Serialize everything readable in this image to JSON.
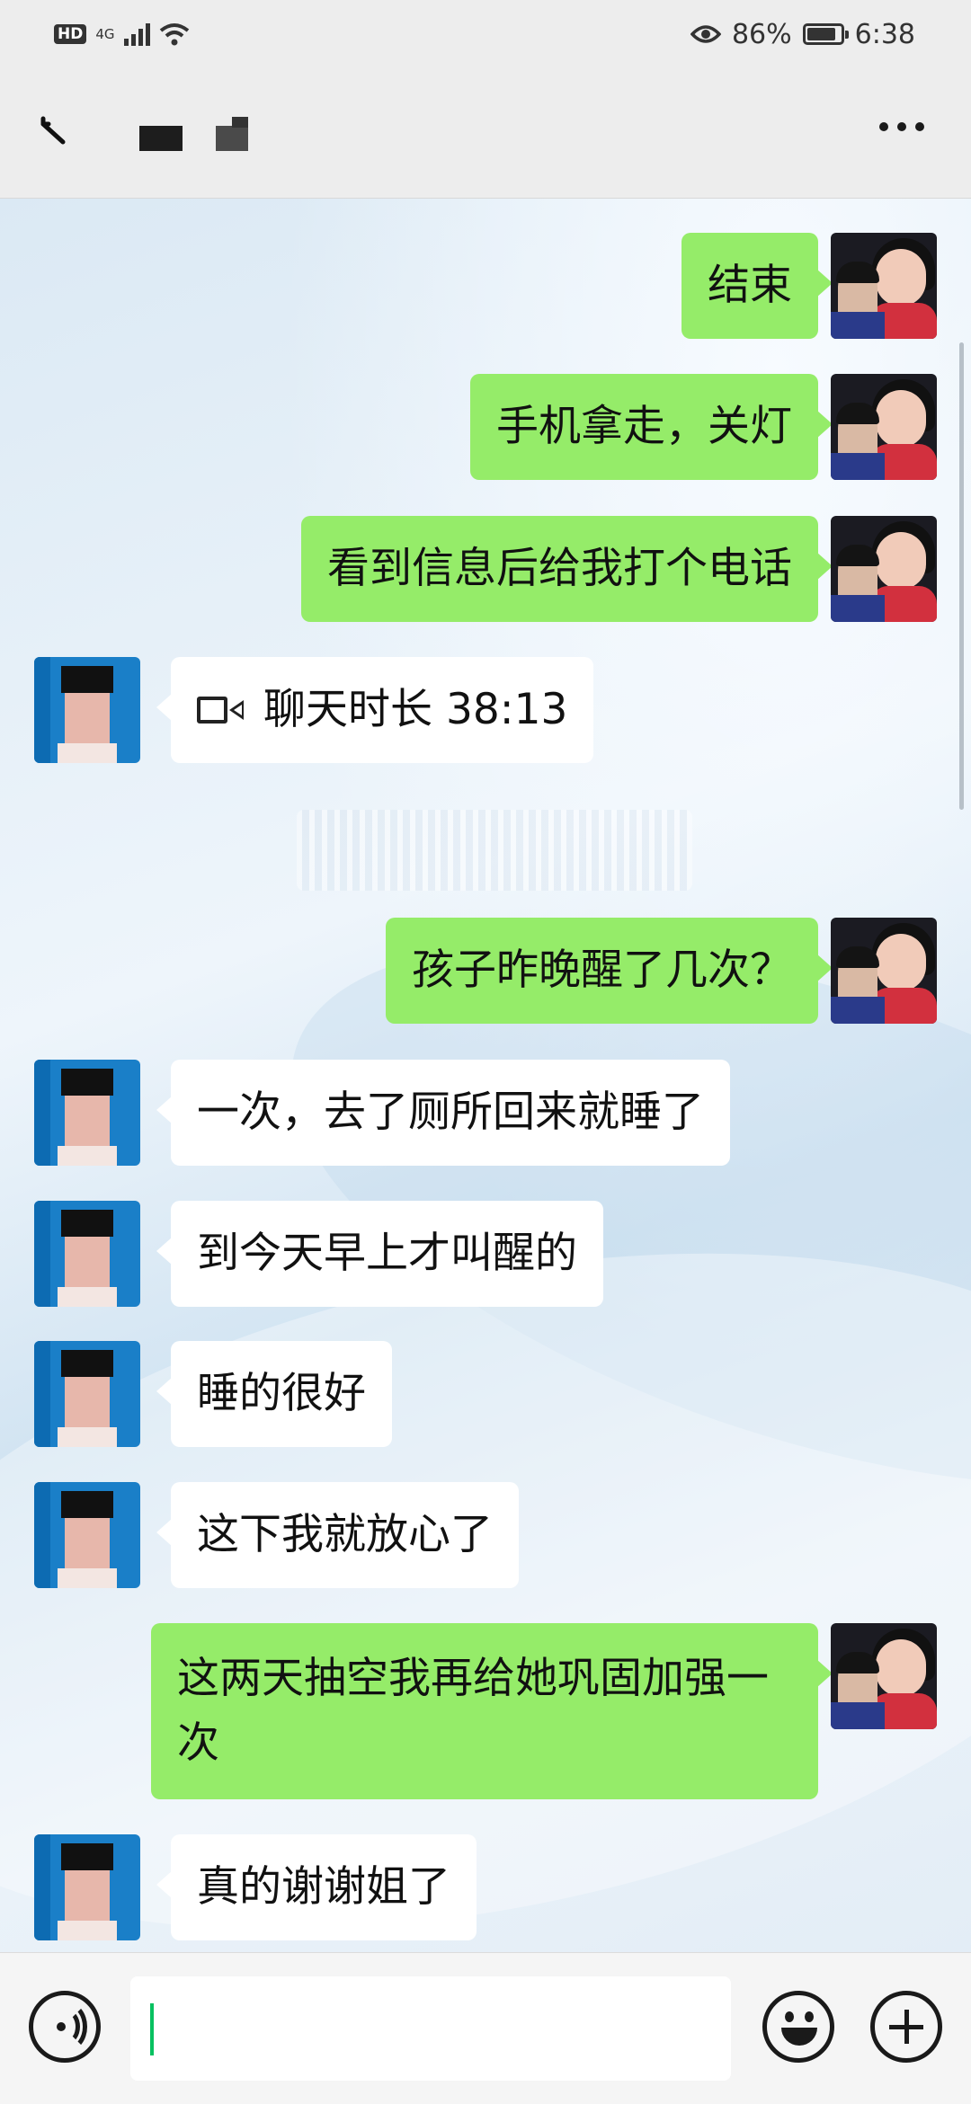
{
  "status_bar": {
    "hd": "HD",
    "network": "4G",
    "battery_percent": "86%",
    "battery_level": 0.86,
    "time": "6:38"
  },
  "header": {
    "title_obscured": true
  },
  "messages": [
    {
      "side": "me",
      "text": "结束"
    },
    {
      "side": "me",
      "text": "手机拿走，关灯"
    },
    {
      "side": "me",
      "text": "看到信息后给我打个电话"
    },
    {
      "side": "other",
      "type": "video-call",
      "text": "聊天时长 38:13"
    },
    {
      "side": "me",
      "text": "孩子昨晚醒了几次？"
    },
    {
      "side": "other",
      "text": "一次，去了厕所回来就睡了"
    },
    {
      "side": "other",
      "text": "到今天早上才叫醒的"
    },
    {
      "side": "other",
      "text": "睡的很好"
    },
    {
      "side": "other",
      "text": "这下我就放心了"
    },
    {
      "side": "me",
      "text": "这两天抽空我再给她巩固加强一次"
    },
    {
      "side": "other",
      "text": "真的谢谢姐了"
    }
  ],
  "input": {
    "value": ""
  },
  "colors": {
    "my_bubble": "#95ec69",
    "other_bubble": "#ffffff",
    "caret": "#07c160"
  }
}
